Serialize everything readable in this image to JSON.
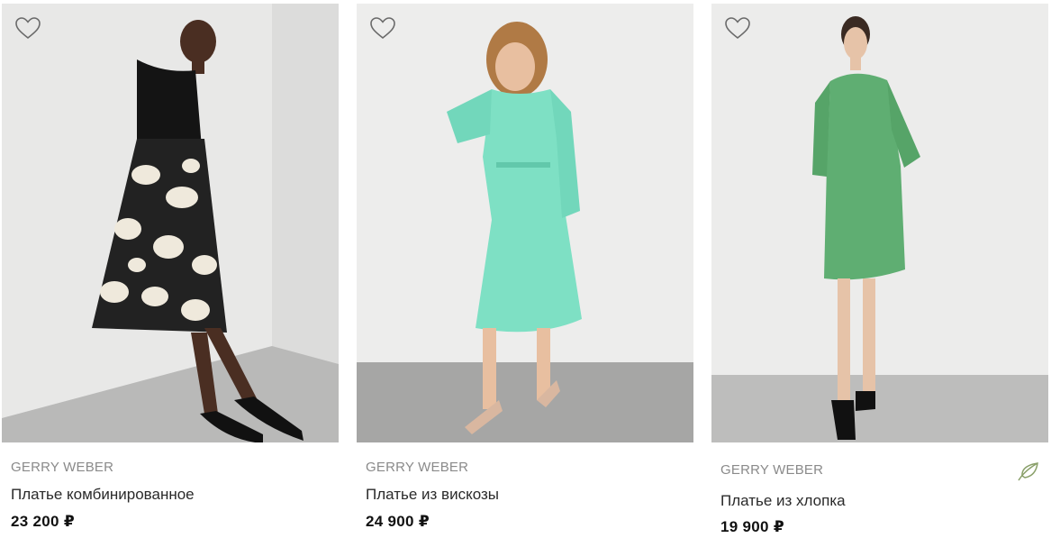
{
  "products": [
    {
      "brand": "GERRY WEBER",
      "title": "Платье комбинированное",
      "price": "23 200 ₽"
    },
    {
      "brand": "GERRY WEBER",
      "title": "Платье из вискозы",
      "price": "24 900 ₽"
    },
    {
      "brand": "GERRY WEBER",
      "title": "Платье из хлопка",
      "price": "19 900 ₽",
      "badge_icon": "eco-leaf-icon"
    }
  ],
  "colors": {
    "accent_leaf": "#8aa06a",
    "text_muted": "#8a8a8a"
  }
}
